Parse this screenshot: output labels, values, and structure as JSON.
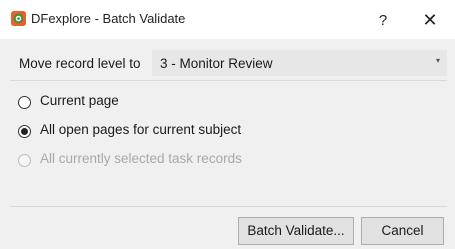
{
  "window": {
    "title": "DFexplore - Batch Validate",
    "help_label": "?",
    "close_label": "✕",
    "app_icon": "dfexplore-app-icon"
  },
  "form": {
    "move_label": "Move record level to",
    "level_select": {
      "value": "3 - Monitor Review",
      "arrow": "▾"
    }
  },
  "options": [
    {
      "label": "Current page",
      "checked": false,
      "disabled": false
    },
    {
      "label": "All open pages for current subject",
      "checked": true,
      "disabled": false
    },
    {
      "label": "All currently selected task records",
      "checked": false,
      "disabled": true
    }
  ],
  "buttons": {
    "batch_validate": "Batch Validate...",
    "cancel": "Cancel"
  }
}
